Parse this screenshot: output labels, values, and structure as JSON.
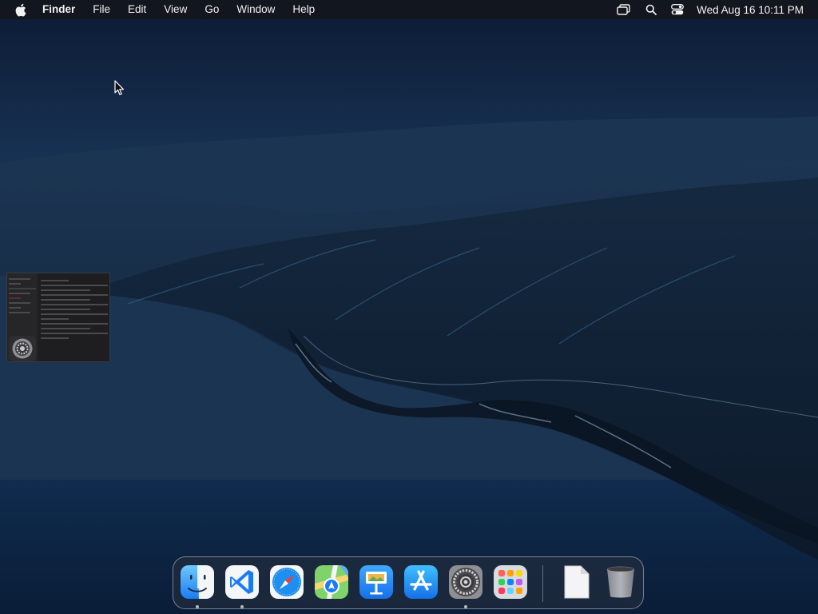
{
  "menubar": {
    "app_menu": "Finder",
    "menus": [
      "File",
      "Edit",
      "View",
      "Go",
      "Window",
      "Help"
    ],
    "clock": "Wed Aug 16  10:11 PM",
    "status_icons": [
      "screen-mirroring-icon",
      "spotlight-search-icon",
      "control-center-icon"
    ]
  },
  "dock": {
    "apps": [
      {
        "name": "Finder",
        "icon": "finder-icon",
        "running": true
      },
      {
        "name": "Visual Studio Code",
        "icon": "vscode-icon",
        "running": true
      },
      {
        "name": "Safari",
        "icon": "safari-icon",
        "running": false
      },
      {
        "name": "Maps",
        "icon": "maps-icon",
        "running": false
      },
      {
        "name": "Keynote",
        "icon": "keynote-icon",
        "running": false
      },
      {
        "name": "App Store",
        "icon": "app-store-icon",
        "running": false
      },
      {
        "name": "System Settings",
        "icon": "system-settings-icon",
        "running": true
      },
      {
        "name": "Launchpad",
        "icon": "launchpad-icon",
        "running": false
      }
    ],
    "others": [
      {
        "name": "Document",
        "icon": "document-icon"
      },
      {
        "name": "Trash",
        "icon": "trash-icon"
      }
    ]
  },
  "desktop": {
    "minimized_window": "System Settings"
  },
  "colors": {
    "menubar_bg": "#16181c",
    "accent_blue": "#1a7cf5"
  }
}
